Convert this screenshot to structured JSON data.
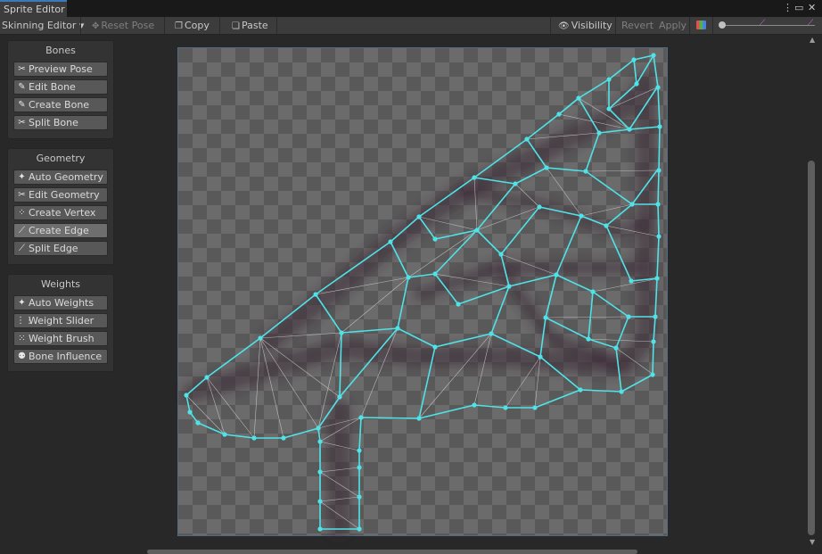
{
  "window": {
    "tab_title": "Sprite Editor",
    "menu_icon": "⋮",
    "maximize_icon": "▭",
    "close_icon": "✕"
  },
  "toolbar": {
    "mode": "Skinning Editor ▾",
    "reset_pose": "Reset Pose",
    "copy": "Copy",
    "paste": "Paste",
    "visibility": "Visibility",
    "revert": "Revert",
    "apply": "Apply"
  },
  "panels": {
    "bones": {
      "title": "Bones",
      "items": [
        {
          "label": "Preview Pose",
          "icon": "preview-pose-icon",
          "glyph": "✂"
        },
        {
          "label": "Edit Bone",
          "icon": "edit-bone-icon",
          "glyph": "✎"
        },
        {
          "label": "Create Bone",
          "icon": "create-bone-icon",
          "glyph": "✎"
        },
        {
          "label": "Split Bone",
          "icon": "split-bone-icon",
          "glyph": "✂"
        }
      ]
    },
    "geometry": {
      "title": "Geometry",
      "items": [
        {
          "label": "Auto Geometry",
          "icon": "auto-geometry-icon",
          "glyph": "✦"
        },
        {
          "label": "Edit Geometry",
          "icon": "edit-geometry-icon",
          "glyph": "✂"
        },
        {
          "label": "Create Vertex",
          "icon": "create-vertex-icon",
          "glyph": "⁘"
        },
        {
          "label": "Create Edge",
          "icon": "create-edge-icon",
          "glyph": "⟋",
          "active": true
        },
        {
          "label": "Split Edge",
          "icon": "split-edge-icon",
          "glyph": "⟋"
        }
      ]
    },
    "weights": {
      "title": "Weights",
      "items": [
        {
          "label": "Auto Weights",
          "icon": "auto-weights-icon",
          "glyph": "✦"
        },
        {
          "label": "Weight Slider",
          "icon": "weight-slider-icon",
          "glyph": "⋮⋮"
        },
        {
          "label": "Weight Brush",
          "icon": "weight-brush-icon",
          "glyph": "⁙"
        },
        {
          "label": "Bone Influence",
          "icon": "bone-influence-icon",
          "glyph": "⚉"
        }
      ]
    }
  },
  "colors": {
    "mesh_edge": "#4fe3e8",
    "mesh_vertex": "#4fe3e8",
    "accent": "#3a79bb"
  }
}
